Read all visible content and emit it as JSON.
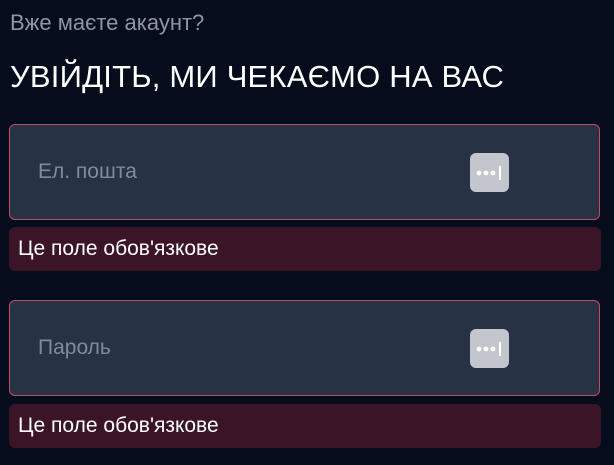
{
  "header": {
    "subtitle": "Вже маєте акаунт?",
    "title": "УВІЙДІТЬ, МИ ЧЕКАЄМО НА ВАС"
  },
  "form": {
    "email": {
      "placeholder": "Ел. пошта",
      "value": "",
      "error": "Це поле обов'язкове",
      "icon": "password-manager-icon"
    },
    "password": {
      "placeholder": "Пароль",
      "value": "",
      "error": "Це поле обов'язкове",
      "icon": "password-manager-icon"
    }
  },
  "colors": {
    "background": "#050c1c",
    "field_background": "#273245",
    "field_border_error": "#c14b5f",
    "error_background": "#3b1427"
  }
}
